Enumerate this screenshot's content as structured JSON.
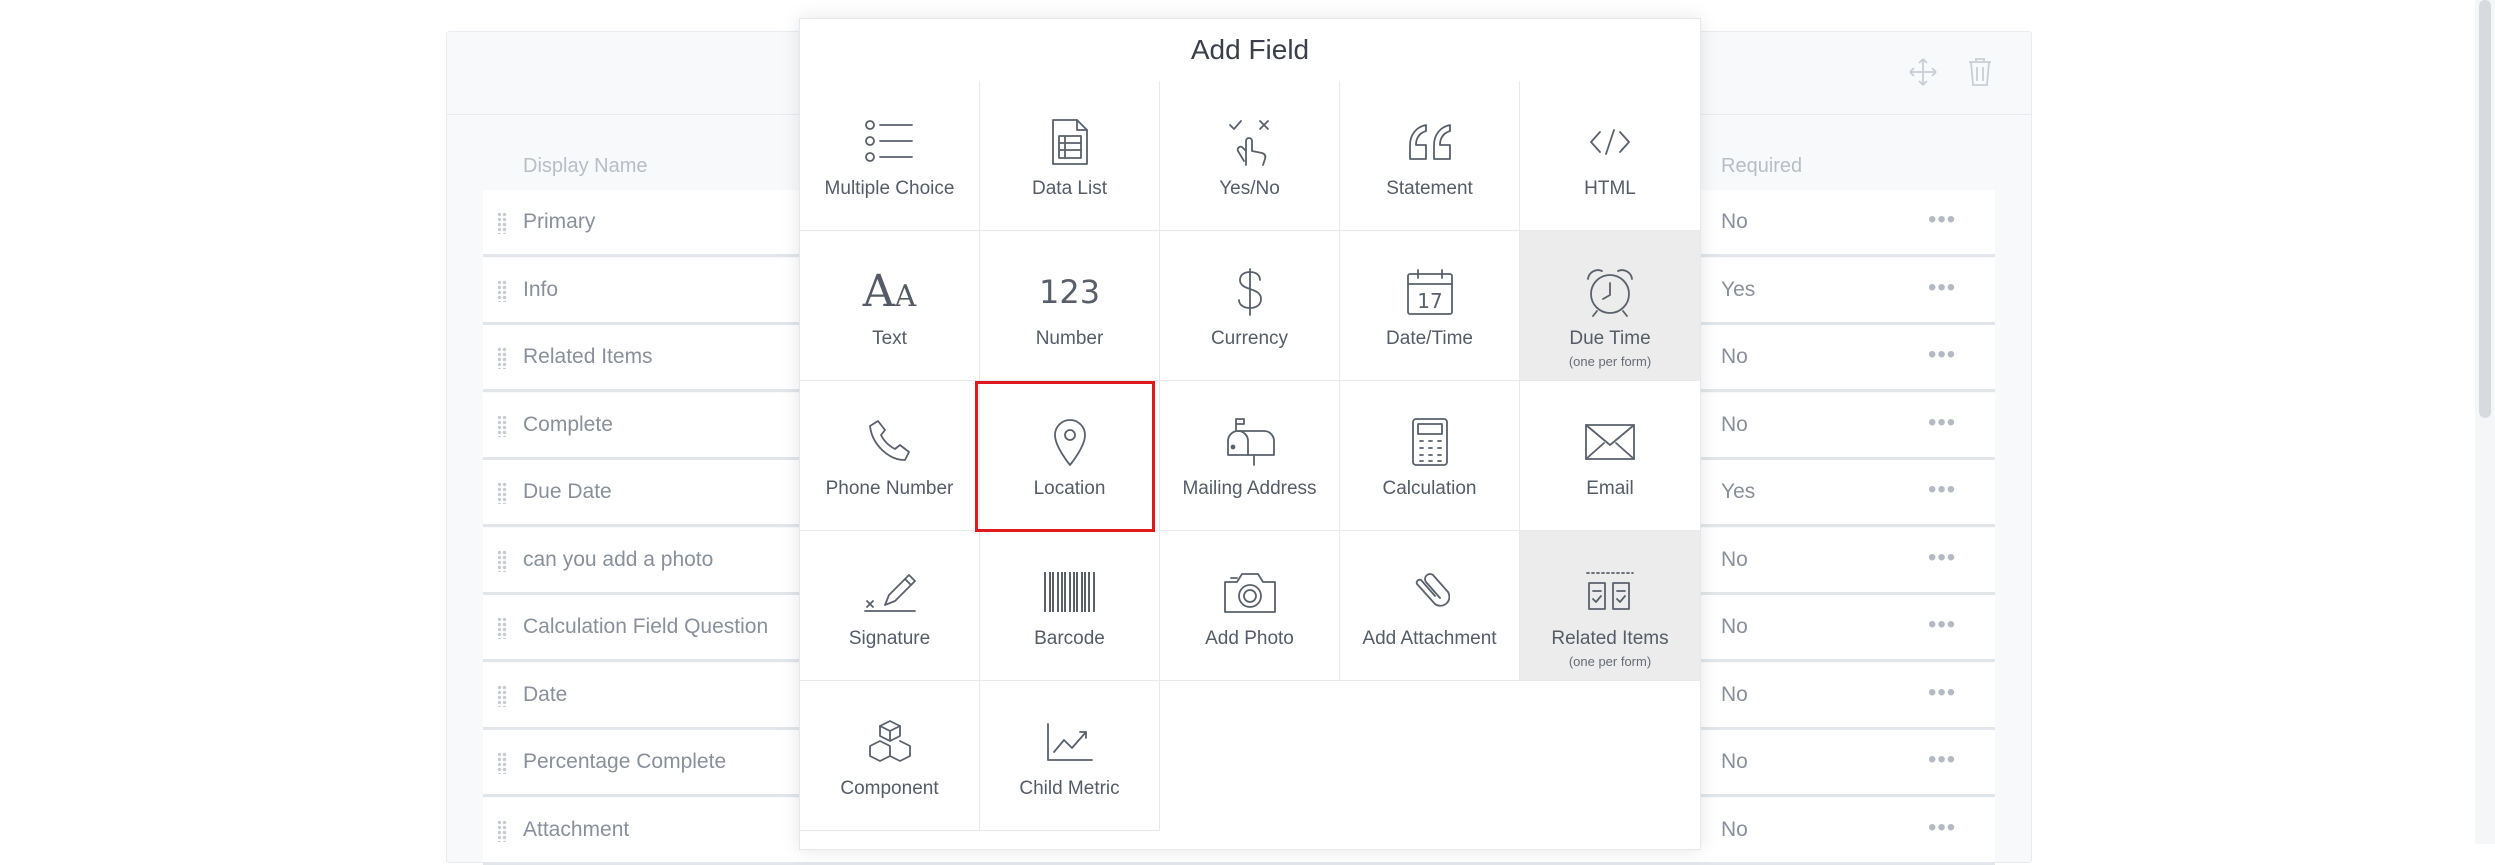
{
  "modal": {
    "title": "Add Field",
    "tiles": [
      {
        "label": "Multiple Choice",
        "icon": "multiple-choice-icon",
        "sub": ""
      },
      {
        "label": "Data List",
        "icon": "data-list-icon",
        "sub": ""
      },
      {
        "label": "Yes/No",
        "icon": "yes-no-icon",
        "sub": ""
      },
      {
        "label": "Statement",
        "icon": "statement-icon",
        "sub": ""
      },
      {
        "label": "HTML",
        "icon": "html-icon",
        "sub": ""
      },
      {
        "label": "Text",
        "icon": "text-icon",
        "sub": ""
      },
      {
        "label": "Number",
        "icon": "number-icon",
        "sub": "",
        "glyph": "123"
      },
      {
        "label": "Currency",
        "icon": "currency-icon",
        "sub": ""
      },
      {
        "label": "Date/Time",
        "icon": "calendar-icon",
        "sub": "",
        "glyph": "17"
      },
      {
        "label": "Due Time",
        "icon": "alarm-clock-icon",
        "sub": "(one per form)"
      },
      {
        "label": "Phone Number",
        "icon": "phone-icon",
        "sub": ""
      },
      {
        "label": "Location",
        "icon": "location-pin-icon",
        "sub": ""
      },
      {
        "label": "Mailing Address",
        "icon": "mailbox-icon",
        "sub": ""
      },
      {
        "label": "Calculation",
        "icon": "calculator-icon",
        "sub": ""
      },
      {
        "label": "Email",
        "icon": "envelope-icon",
        "sub": ""
      },
      {
        "label": "Signature",
        "icon": "signature-icon",
        "sub": ""
      },
      {
        "label": "Barcode",
        "icon": "barcode-icon",
        "sub": ""
      },
      {
        "label": "Add Photo",
        "icon": "camera-icon",
        "sub": ""
      },
      {
        "label": "Add Attachment",
        "icon": "paperclip-icon",
        "sub": ""
      },
      {
        "label": "Related Items",
        "icon": "related-items-icon",
        "sub": "(one per form)"
      },
      {
        "label": "Component",
        "icon": "cubes-icon",
        "sub": ""
      },
      {
        "label": "Child Metric",
        "icon": "chart-line-icon",
        "sub": ""
      }
    ]
  },
  "form": {
    "columns": {
      "display_name": "Display Name",
      "required": "Required"
    },
    "rows": [
      {
        "name": "Primary",
        "required": "No"
      },
      {
        "name": "Info",
        "required": "Yes"
      },
      {
        "name": "Related Items",
        "required": "No"
      },
      {
        "name": "Complete",
        "required": "No"
      },
      {
        "name": "Due Date",
        "required": "Yes"
      },
      {
        "name": "can you add a photo",
        "required": "No"
      },
      {
        "name": "Calculation Field Question",
        "required": "No"
      },
      {
        "name": "Date",
        "required": "No"
      },
      {
        "name": "Percentage Complete",
        "required": "No"
      },
      {
        "name": "Attachment",
        "required": "No"
      }
    ],
    "more_glyph": "•••",
    "header_icons": [
      "move-arrows-icon",
      "trash-icon"
    ]
  },
  "colors": {
    "highlight": "#e0191f",
    "disabled_tile": "#ececec",
    "icon_stroke": "#5a616b"
  }
}
